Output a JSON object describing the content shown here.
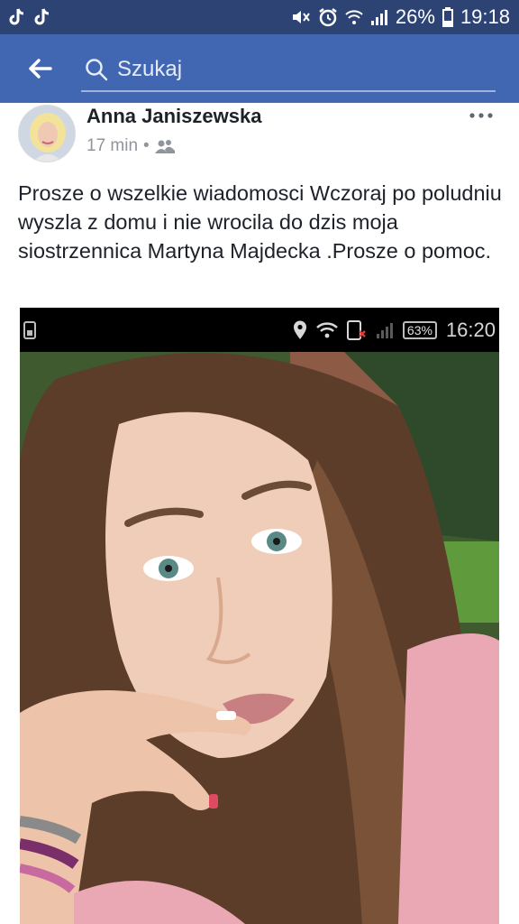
{
  "status_bar": {
    "left_icons": [
      "tiktok-icon",
      "tiktok-icon"
    ],
    "right_icons": [
      "mute-icon",
      "alarm-icon",
      "wifi-icon",
      "signal-icon"
    ],
    "battery": "26%",
    "time": "19:18"
  },
  "header": {
    "back_icon": "arrow-left-icon",
    "search_icon": "search-icon",
    "search_placeholder": "Szukaj"
  },
  "post": {
    "author": "Anna Janiszewska",
    "time_ago": "17 min",
    "audience_icon": "friends-icon",
    "text": "Prosze o wszelkie wiadomosci Wczoraj po poludniu wyszla z domu i nie wrocila do dzis moja siostrzennica Martyna Majdecka .Prosze o pomoc.",
    "more_icon": "more-horizontal-icon"
  },
  "photo": {
    "status_bar": {
      "battery": "63%",
      "time": "16:20"
    }
  },
  "colors": {
    "status_bar_bg": "#2d4373",
    "header_bg": "#4267b2",
    "text_primary": "#1d2129",
    "text_secondary": "#90949c"
  }
}
